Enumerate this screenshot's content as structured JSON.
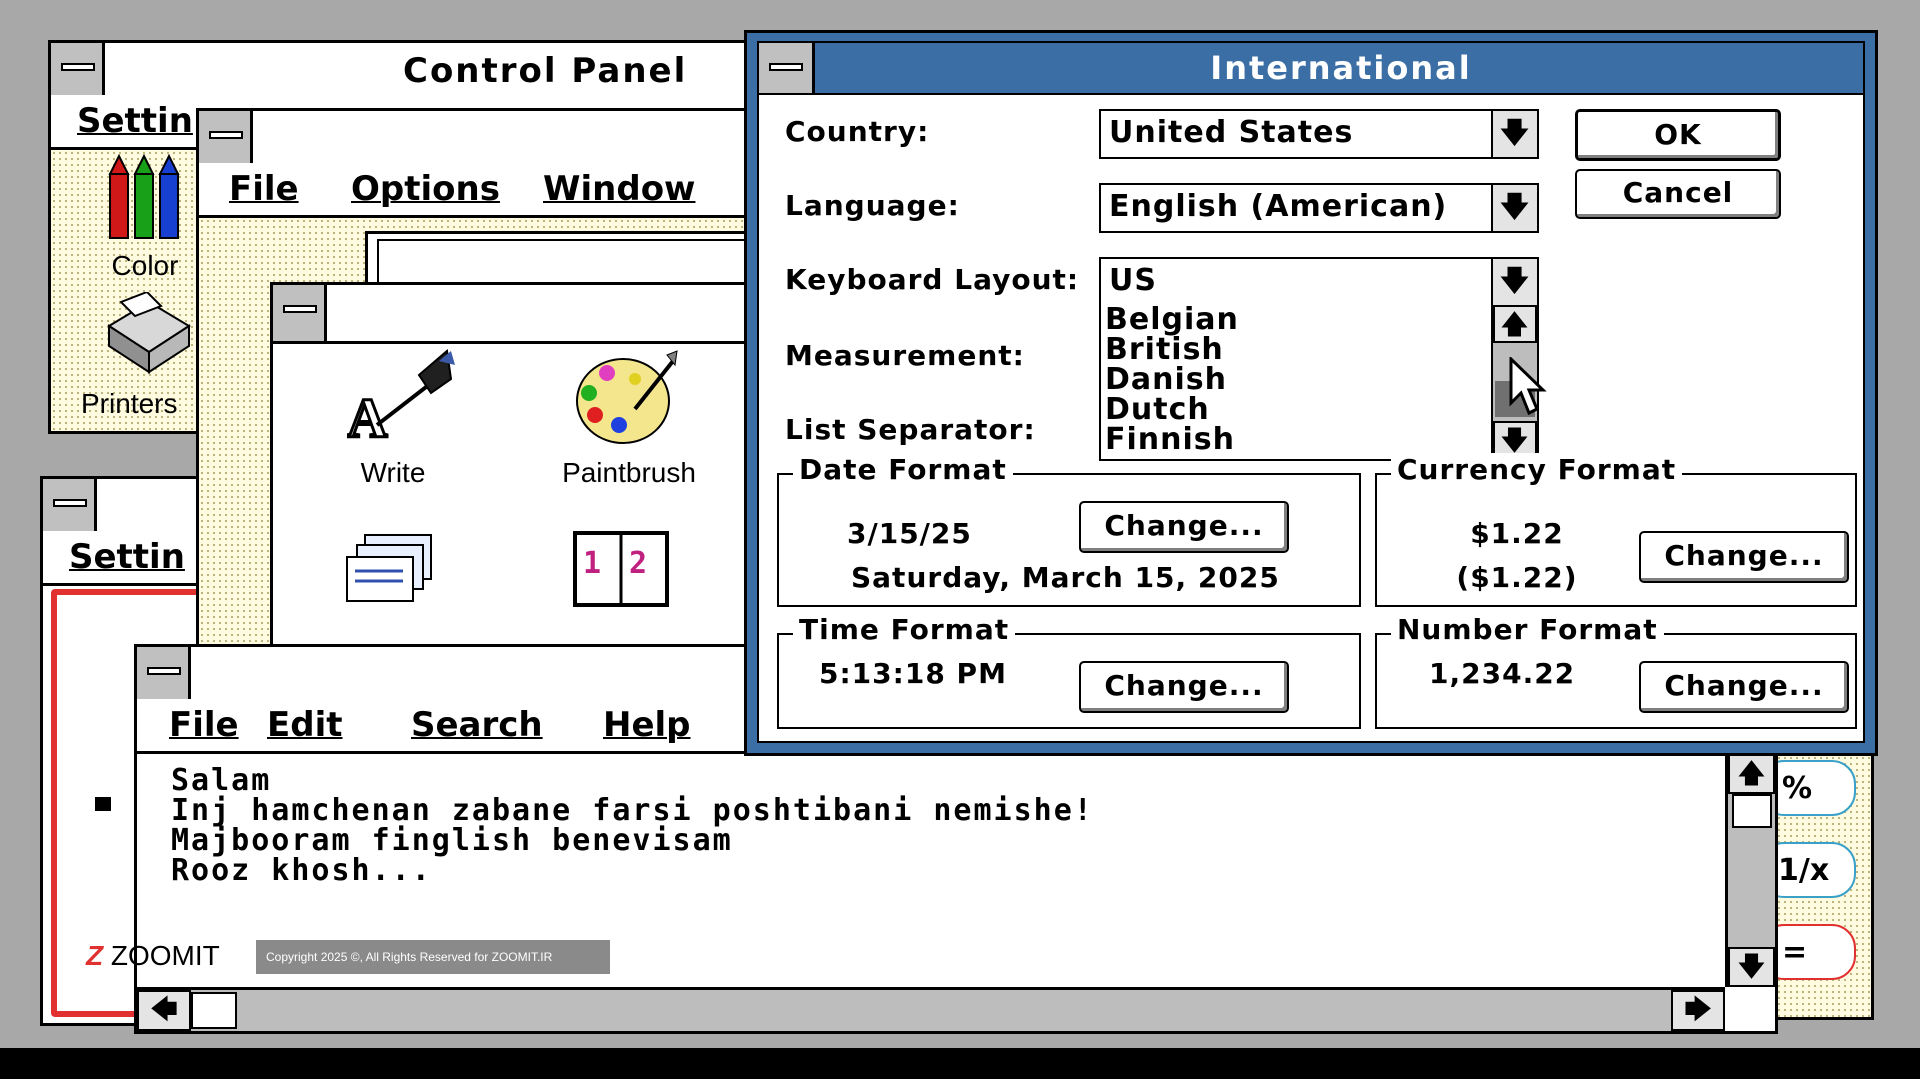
{
  "control_panel": {
    "title": "Control Panel",
    "menu": [
      "Settin"
    ],
    "icons": [
      {
        "name": "color-icon",
        "label": "Color"
      },
      {
        "name": "printers-icon",
        "label": "Printers"
      }
    ]
  },
  "program_manager": {
    "menu": [
      "File",
      "Options",
      "Window"
    ]
  },
  "accessories": {
    "icons": [
      {
        "label": "Write"
      },
      {
        "label": "Paintbrush"
      },
      {
        "label": "Cardfile"
      },
      {
        "label": "Calendar"
      }
    ]
  },
  "second_window": {
    "menu": [
      "Settin"
    ]
  },
  "notepad": {
    "menu": [
      "File",
      "Edit",
      "Search",
      "Help"
    ],
    "lines": [
      "Salam",
      "Inj hamchenan zabane farsi poshtibani nemishe!",
      "Majbooram finglish benevisam",
      "Rooz khosh..."
    ]
  },
  "calculator": {
    "keys": [
      "%",
      "1/x",
      "="
    ]
  },
  "dialog": {
    "title": "International",
    "country_label": "Country:",
    "country_value": "United States",
    "language_label": "Language:",
    "language_value": "English (American)",
    "keyboard_label": "Keyboard Layout:",
    "keyboard_value": "US",
    "keyboard_options": [
      "Belgian",
      "British",
      "Danish",
      "Dutch",
      "Finnish"
    ],
    "measurement_label": "Measurement:",
    "list_separator_label": "List Separator:",
    "ok": "OK",
    "cancel": "Cancel",
    "date_format": {
      "title": "Date Format",
      "short": "3/15/25",
      "long": "Saturday, March 15, 2025",
      "change": "Change..."
    },
    "currency_format": {
      "title": "Currency Format",
      "positive": "$1.22",
      "negative": "($1.22)",
      "change": "Change..."
    },
    "time_format": {
      "title": "Time Format",
      "value": "5:13:18 PM",
      "change": "Change..."
    },
    "number_format": {
      "title": "Number Format",
      "value": "1,234.22",
      "change": "Change..."
    }
  },
  "watermark": {
    "brand": "ZOOMIT",
    "copyright": "Copyright 2025 ©, All Rights Reserved for ZOOMIT.IR"
  },
  "colors": {
    "desktop": "#a8a8a8",
    "dialog_title": "#3a6ea5",
    "accent_red": "#e03030"
  }
}
